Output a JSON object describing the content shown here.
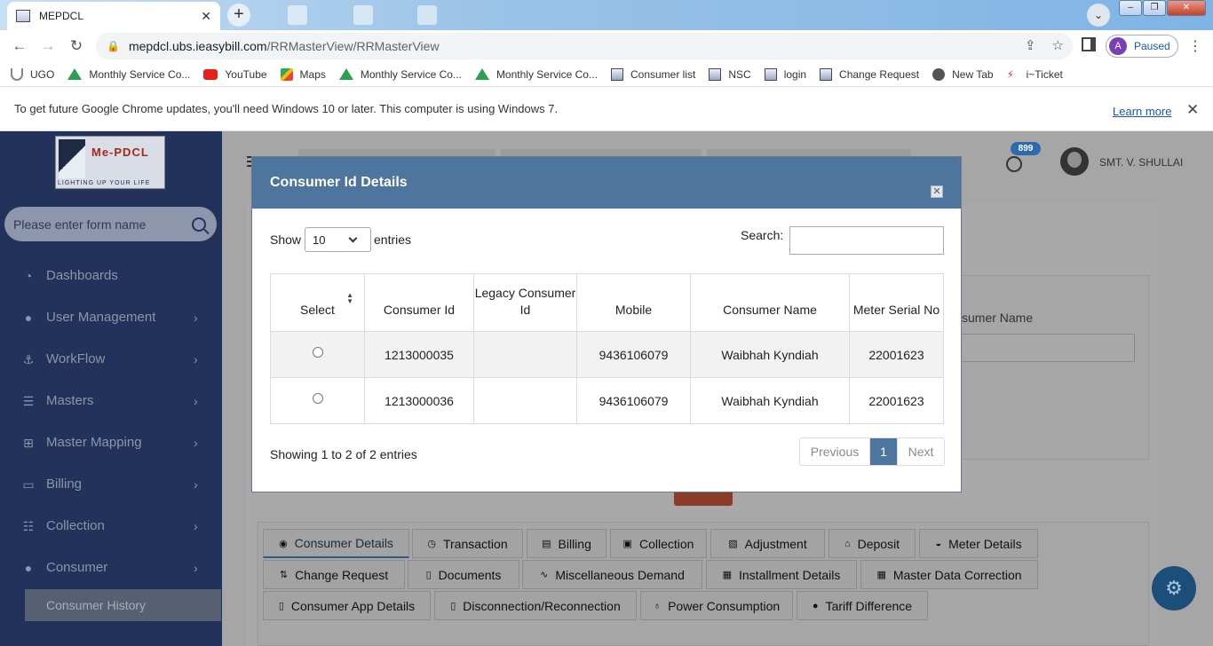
{
  "browser": {
    "tab_title": "MEPDCL",
    "url_host": "mepdcl.ubs.ieasybill.com",
    "url_path": "/RRMasterView/RRMasterView",
    "profile_initial": "A",
    "profile_status": "Paused",
    "bookmarks": [
      "UGO",
      "Monthly Service Co...",
      "YouTube",
      "Maps",
      "Monthly Service Co...",
      "Monthly Service Co...",
      "Consumer list",
      "NSC",
      "login",
      "Change Request",
      "New Tab",
      "i~Ticket"
    ],
    "infobar_text": "To get future Google Chrome updates, you'll need Windows 10 or later. This computer is using Windows 7.",
    "infobar_link": "Learn more"
  },
  "sidebar": {
    "logo_text": "Me-PDCL",
    "logo_tagline": "LIGHTING UP YOUR LIFE",
    "search_placeholder": "Please enter form name",
    "items": [
      {
        "label": "Dashboards"
      },
      {
        "label": "User Management"
      },
      {
        "label": "WorkFlow"
      },
      {
        "label": "Masters"
      },
      {
        "label": "Master Mapping"
      },
      {
        "label": "Billing"
      },
      {
        "label": "Collection"
      },
      {
        "label": "Consumer"
      }
    ],
    "submenu_active": "Consumer History"
  },
  "header": {
    "notification_count": "899",
    "user_name": "SMT. V. SHULLAI"
  },
  "background": {
    "field_label": "sumer Name",
    "tabs_row1": [
      "Consumer Details",
      "Transaction",
      "Billing",
      "Collection",
      "Adjustment",
      "Deposit",
      "Meter Details"
    ],
    "tabs_row2": [
      "Change Request",
      "Documents",
      "Miscellaneous Demand",
      "Installment Details",
      "Master Data Correction"
    ],
    "tabs_row3": [
      "Consumer App Details",
      "Disconnection/Reconnection",
      "Power Consumption",
      "Tariff Difference"
    ]
  },
  "modal": {
    "title": "Consumer Id Details",
    "show_label": "Show",
    "length_value": "10",
    "entries_label": "entries",
    "search_label": "Search:",
    "columns": [
      "Select",
      "Consumer Id",
      "Legacy Consumer Id",
      "Mobile",
      "Consumer Name",
      "Meter Serial No"
    ],
    "rows": [
      {
        "consumer_id": "1213000035",
        "legacy_id": "",
        "mobile": "9436106079",
        "name": "Waibhah Kyndiah",
        "meter": "22001623"
      },
      {
        "consumer_id": "1213000036",
        "legacy_id": "",
        "mobile": "9436106079",
        "name": "Waibhah Kyndiah",
        "meter": "22001623"
      }
    ],
    "info": "Showing 1 to 2 of 2 entries",
    "pager": {
      "previous": "Previous",
      "current": "1",
      "next": "Next"
    }
  }
}
